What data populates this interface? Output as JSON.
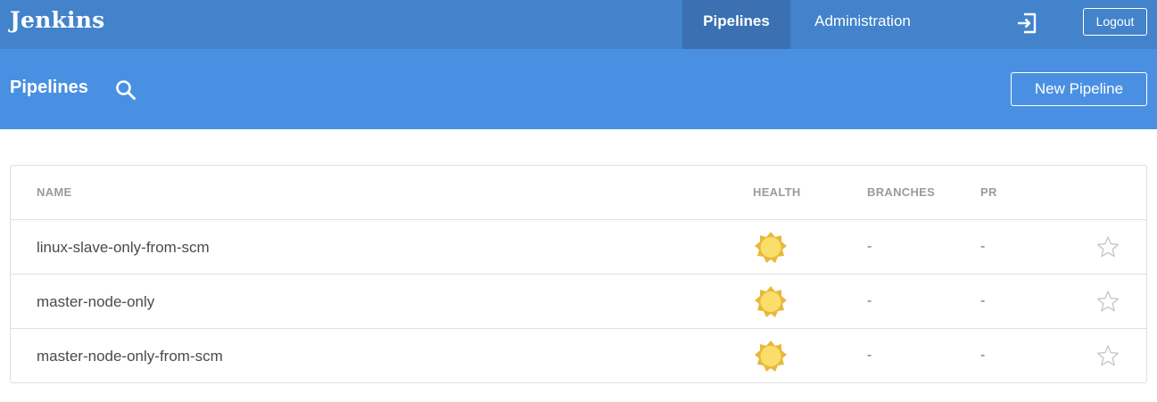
{
  "topbar": {
    "logo": "Jenkins",
    "tabs": [
      {
        "label": "Pipelines",
        "active": true
      },
      {
        "label": "Administration",
        "active": false
      }
    ],
    "logout_label": "Logout",
    "accent": "#4283cb"
  },
  "subheader": {
    "title": "Pipelines",
    "new_pipeline_label": "New Pipeline",
    "accent": "#4a90e2"
  },
  "table": {
    "columns": [
      "NAME",
      "HEALTH",
      "BRANCHES",
      "PR"
    ],
    "rows": [
      {
        "name": "linux-slave-only-from-scm",
        "health": "sunny-icon",
        "branches": "-",
        "pr": "-"
      },
      {
        "name": "master-node-only",
        "health": "sunny-icon",
        "branches": "-",
        "pr": "-"
      },
      {
        "name": "master-node-only-from-scm",
        "health": "sunny-icon",
        "branches": "-",
        "pr": "-"
      }
    ]
  }
}
